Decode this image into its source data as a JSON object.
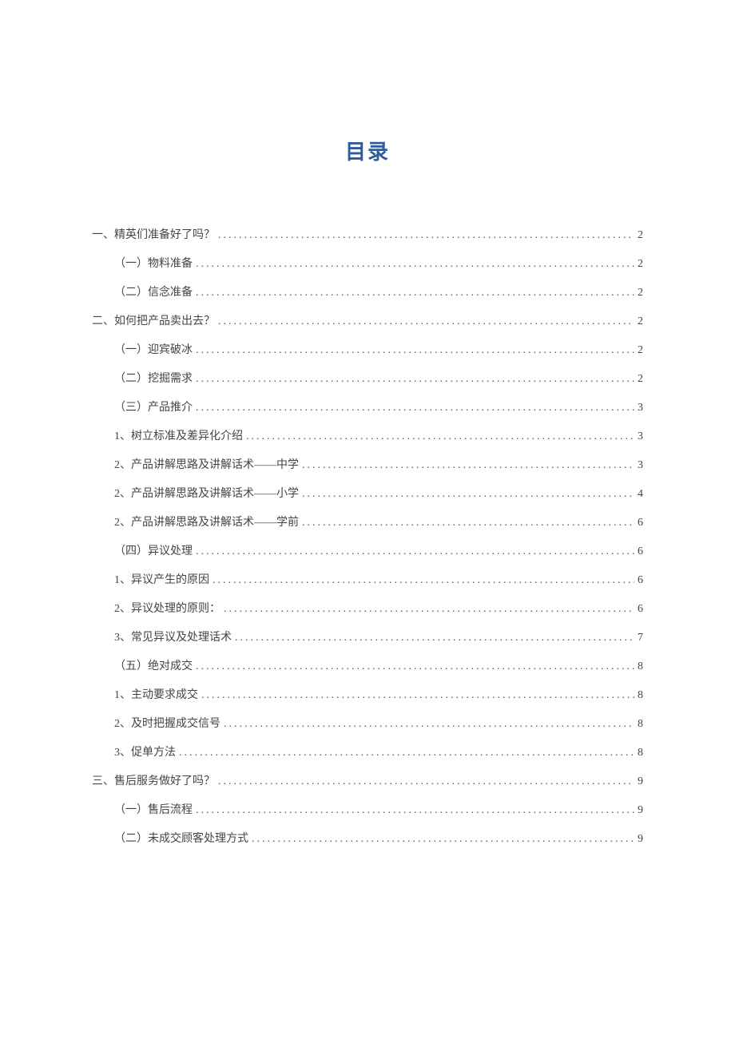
{
  "title": "目录",
  "entries": [
    {
      "level": 1,
      "label": "一、精英们准备好了吗？",
      "page": "2"
    },
    {
      "level": 2,
      "label": "（一）物料准备",
      "page": "2"
    },
    {
      "level": 2,
      "label": "（二）信念准备",
      "page": "2"
    },
    {
      "level": 1,
      "label": "二、如何把产品卖出去？",
      "page": "2"
    },
    {
      "level": 2,
      "label": "（一）迎宾破冰",
      "page": "2"
    },
    {
      "level": 2,
      "label": "（二）挖掘需求",
      "page": "2"
    },
    {
      "level": 2,
      "label": "（三）产品推介",
      "page": "3"
    },
    {
      "level": 2,
      "label": "1、树立标准及差异化介绍",
      "page": "3"
    },
    {
      "level": 2,
      "label": "2、产品讲解思路及讲解话术——中学",
      "page": "3"
    },
    {
      "level": 2,
      "label": "2、产品讲解思路及讲解话术——小学",
      "page": "4"
    },
    {
      "level": 2,
      "label": "2、产品讲解思路及讲解话术——学前",
      "page": "6"
    },
    {
      "level": 2,
      "label": "（四）异议处理",
      "page": "6"
    },
    {
      "level": 2,
      "label": "1、异议产生的原因",
      "page": "6"
    },
    {
      "level": 2,
      "label": "2、异议处理的原则：",
      "page": "6"
    },
    {
      "level": 2,
      "label": "3、常见异议及处理话术",
      "page": "7"
    },
    {
      "level": 2,
      "label": "（五）绝对成交",
      "page": "8"
    },
    {
      "level": 2,
      "label": "1、主动要求成交",
      "page": "8"
    },
    {
      "level": 2,
      "label": "2、及时把握成交信号",
      "page": "8"
    },
    {
      "level": 2,
      "label": "3、促单方法",
      "page": "8"
    },
    {
      "level": 1,
      "label": "三、售后服务做好了吗？",
      "page": "9"
    },
    {
      "level": 2,
      "label": "（一）售后流程",
      "page": "9"
    },
    {
      "level": 2,
      "label": "（二）未成交顾客处理方式",
      "page": "9"
    }
  ]
}
